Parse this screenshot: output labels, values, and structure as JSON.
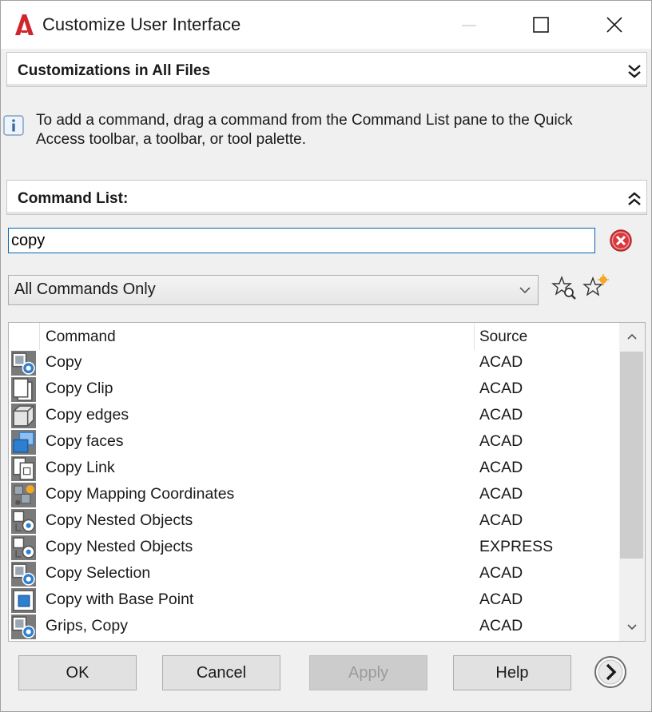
{
  "window": {
    "title": "Customize User Interface",
    "app_icon": "autocad-a-icon",
    "controls": [
      "minimize-icon",
      "maximize-icon",
      "close-icon"
    ]
  },
  "customizations_header": {
    "label": "Customizations in All Files",
    "icon": "chevron-double-down-icon"
  },
  "info": {
    "icon": "info-icon",
    "text": "To add a command, drag a command from the Command List pane to the Quick Access toolbar, a toolbar, or tool palette."
  },
  "command_list": {
    "header": "Command List:",
    "header_icon": "chevron-double-up-icon",
    "search": {
      "value": "copy",
      "clear_icon": "clear-search-icon"
    },
    "filter": {
      "selected": "All Commands Only",
      "tool_icons": [
        "find-command-icon",
        "create-new-command-icon"
      ]
    },
    "columns": [
      "Command",
      "Source"
    ],
    "rows": [
      {
        "command": "Copy",
        "source": "ACAD",
        "icon": "copy-icon"
      },
      {
        "command": "Copy Clip",
        "source": "ACAD",
        "icon": "copy-clip-icon"
      },
      {
        "command": "Copy edges",
        "source": "ACAD",
        "icon": "copy-edges-icon"
      },
      {
        "command": "Copy faces",
        "source": "ACAD",
        "icon": "copy-faces-icon"
      },
      {
        "command": "Copy Link",
        "source": "ACAD",
        "icon": "copy-link-icon"
      },
      {
        "command": "Copy Mapping Coordinates",
        "source": "ACAD",
        "icon": "copy-mapping-icon"
      },
      {
        "command": "Copy Nested Objects",
        "source": "ACAD",
        "icon": "copy-nested-icon"
      },
      {
        "command": "Copy Nested Objects",
        "source": "EXPRESS",
        "icon": "copy-nested-icon"
      },
      {
        "command": "Copy Selection",
        "source": "ACAD",
        "icon": "copy-selection-icon"
      },
      {
        "command": "Copy with Base Point",
        "source": "ACAD",
        "icon": "copy-base-point-icon"
      },
      {
        "command": "Grips, Copy",
        "source": "ACAD",
        "icon": "grips-copy-icon"
      }
    ]
  },
  "footer": {
    "ok": "OK",
    "cancel": "Cancel",
    "apply": "Apply",
    "help": "Help",
    "next_icon": "chevron-right-circle-icon"
  },
  "colors": {
    "accent_red": "#d0262d",
    "focus_blue": "#0a64b4",
    "icon_blue": "#2f7fd0"
  }
}
